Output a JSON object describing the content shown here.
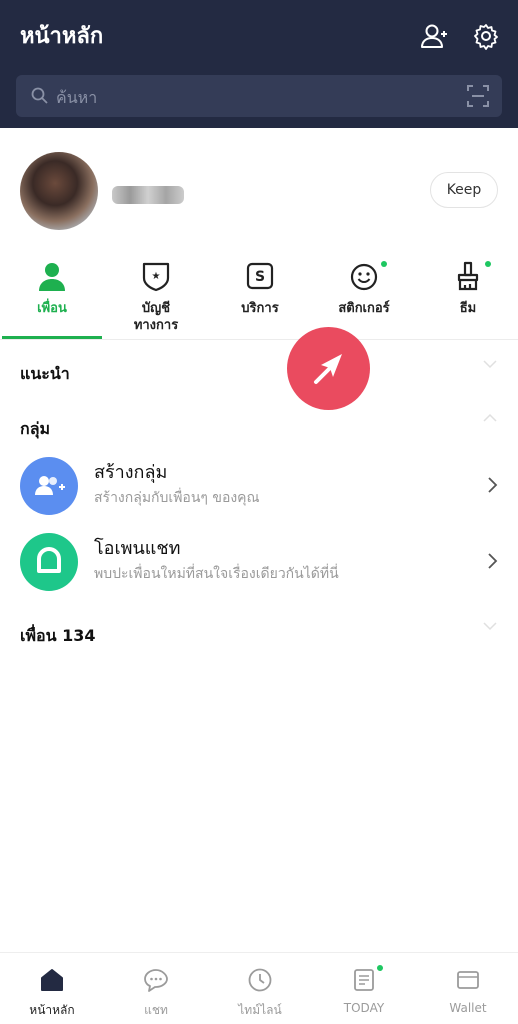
{
  "header": {
    "title": "หน้าหลัก",
    "add_friend_icon": "person-add-icon",
    "settings_icon": "gear-icon",
    "search": {
      "placeholder": "ค้นหา",
      "scan_icon": "scan-icon"
    }
  },
  "profile": {
    "keep_label": "Keep"
  },
  "tabs": [
    {
      "label": "เพื่อน",
      "icon": "person-icon",
      "active": true
    },
    {
      "label": "บัญชี\nทางการ",
      "icon": "official-shield-icon",
      "active": false
    },
    {
      "label": "บริการ",
      "icon": "service-s-icon",
      "active": false
    },
    {
      "label": "สติกเกอร์",
      "icon": "smiley-icon",
      "active": false,
      "badge": true
    },
    {
      "label": "ธีม",
      "icon": "brush-icon",
      "active": false,
      "badge": true
    }
  ],
  "sections": {
    "recommended": "แนะนำ",
    "groups": "กลุ่ม",
    "friends": "เพื่อน 134"
  },
  "group_rows": [
    {
      "title": "สร้างกลุ่ม",
      "subtitle": "สร้างกลุ่มกับเพื่อนๆ ของคุณ",
      "icon": "create-group-icon",
      "color": "#5b8ef0"
    },
    {
      "title": "โอเพนแชท",
      "subtitle": "พบปะเพื่อนใหม่ที่สนใจเรื่องเดียวกันได้ที่นี่",
      "icon": "openchat-icon",
      "color": "#1ec78a"
    }
  ],
  "bottom_nav": [
    {
      "label": "หน้าหลัก",
      "icon": "home-icon",
      "active": true
    },
    {
      "label": "แชท",
      "icon": "chat-icon",
      "active": false
    },
    {
      "label": "ไทม์ไลน์",
      "icon": "clock-icon",
      "active": false
    },
    {
      "label": "TODAY",
      "icon": "news-icon",
      "active": false,
      "badge": true
    },
    {
      "label": "Wallet",
      "icon": "wallet-icon",
      "active": false
    }
  ],
  "colors": {
    "header_bg": "#232a42",
    "accent_green": "#1eb04f",
    "fab_red": "#ea4b5f"
  }
}
